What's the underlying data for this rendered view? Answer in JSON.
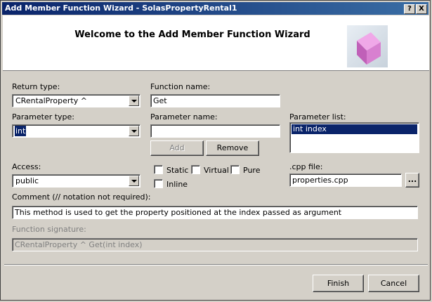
{
  "window": {
    "title": "Add Member Function Wizard - SolasPropertyRental1",
    "help_label": "?",
    "close_label": "X"
  },
  "header": {
    "title": "Welcome to the Add Member Function Wizard"
  },
  "return_type": {
    "label": "Return type:",
    "value": "CRentalProperty ^"
  },
  "function_name": {
    "label": "Function name:",
    "value": "Get"
  },
  "parameter_type": {
    "label": "Parameter type:",
    "value": "int"
  },
  "parameter_name": {
    "label": "Parameter name:",
    "value": ""
  },
  "parameter_list": {
    "label": "Parameter list:",
    "items": [
      "int index"
    ]
  },
  "buttons": {
    "add": "Add",
    "remove": "Remove",
    "browse": "...",
    "finish": "Finish",
    "cancel": "Cancel"
  },
  "access": {
    "label": "Access:",
    "value": "public"
  },
  "checkboxes": {
    "static": "Static",
    "virtual": "Virtual",
    "pure": "Pure",
    "inline": "Inline"
  },
  "cpp_file": {
    "label": ".cpp file:",
    "value": "properties.cpp"
  },
  "comment": {
    "label": "Comment (// notation not required):",
    "value": "This method is used to get the property positioned at the index passed as argument"
  },
  "signature": {
    "label": "Function signature:",
    "value": "CRentalProperty ^ Get(int index)"
  }
}
